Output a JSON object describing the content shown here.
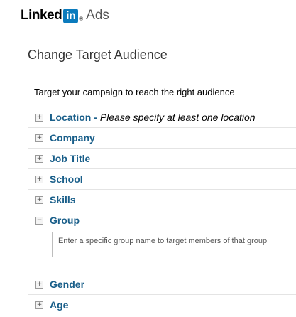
{
  "brand": {
    "linked": "Linked",
    "in": "in",
    "reg": "®",
    "product": "Ads"
  },
  "page": {
    "title": "Change Target Audience",
    "intro": "Target your campaign to reach the right audience"
  },
  "criteria": [
    {
      "label": "Location -",
      "hint": "Please specify at least one location",
      "toggle": "+",
      "expanded": false
    },
    {
      "label": "Company",
      "hint": "",
      "toggle": "+",
      "expanded": false
    },
    {
      "label": "Job Title",
      "hint": "",
      "toggle": "+",
      "expanded": false
    },
    {
      "label": "School",
      "hint": "",
      "toggle": "+",
      "expanded": false
    },
    {
      "label": "Skills",
      "hint": "",
      "toggle": "+",
      "expanded": false
    },
    {
      "label": "Group",
      "hint": "",
      "toggle": "−",
      "expanded": true
    },
    {
      "label": "Gender",
      "hint": "",
      "toggle": "+",
      "expanded": false
    },
    {
      "label": "Age",
      "hint": "",
      "toggle": "+",
      "expanded": false
    }
  ],
  "group_input": {
    "value": "",
    "placeholder": "Enter a specific group name to target members of that group"
  },
  "colors": {
    "link": "#1a5f8a",
    "brand_blue": "#0b7bbd"
  },
  "icons": {
    "expand": "plus-box-icon",
    "collapse": "minus-box-icon"
  }
}
